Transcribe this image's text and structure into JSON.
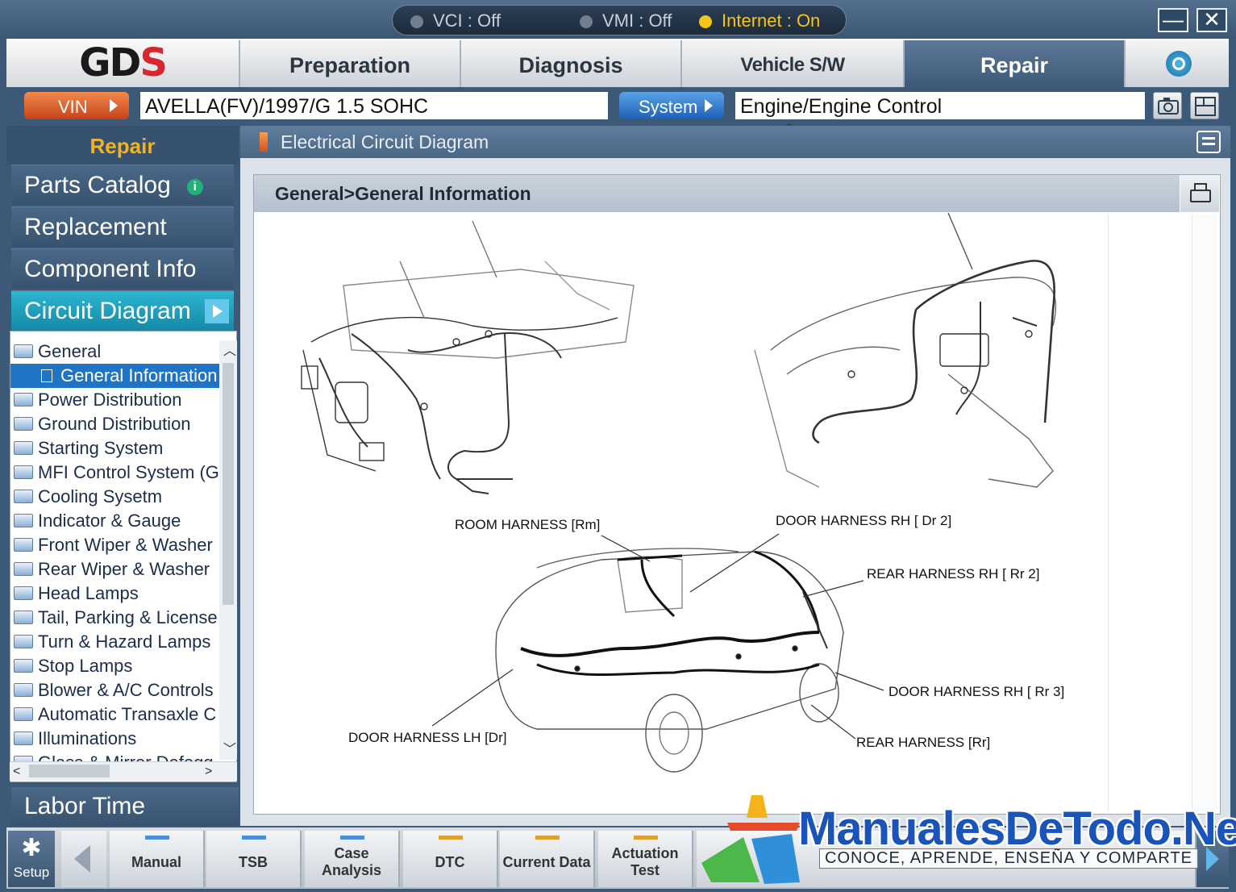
{
  "status": {
    "vci": "VCI : Off",
    "vmi": "VMI : Off",
    "internet": "Internet : On",
    "colors": {
      "off": "#6f7f8f",
      "on": "#f5c518"
    }
  },
  "window": {
    "minimize": "—",
    "close": "✕"
  },
  "logo": {
    "text_a": "GD",
    "text_b": "S"
  },
  "nav_tabs": [
    {
      "label": "Preparation"
    },
    {
      "label": "Diagnosis"
    },
    {
      "label": "Vehicle S/W Management"
    },
    {
      "label": "Repair"
    }
  ],
  "vin_bar": {
    "vin_label": "VIN",
    "vin_value": "AVELLA(FV)/1997/G 1.5 SOHC",
    "system_label": "System",
    "system_value": "Engine/Engine Control"
  },
  "sidebar": {
    "header": "Repair",
    "items": [
      {
        "label": "Parts Catalog",
        "badge": "i"
      },
      {
        "label": "Replacement"
      },
      {
        "label": "Component Info"
      },
      {
        "label": "Circuit Diagram"
      }
    ],
    "footer": "Labor Time"
  },
  "tree": {
    "root": "General",
    "selected": "General Information",
    "items": [
      "Power Distribution",
      "Ground Distribution",
      "Starting System",
      "MFI Control System (G",
      "Cooling Sysetm",
      "Indicator & Gauge",
      "Front Wiper & Washer",
      "Rear Wiper & Washer",
      "Head Lamps",
      "Tail, Parking & License",
      "Turn & Hazard Lamps",
      "Stop Lamps",
      "Blower & A/C Controls",
      "Automatic Transaxle C",
      "Illuminations",
      "Glass & Mirror Defogg"
    ]
  },
  "content": {
    "header": "Electrical Circuit Diagram",
    "breadcrumb": "General>General Information",
    "labels": {
      "room": "ROOM HARNESS [Rm]",
      "door_rh_dr2": "DOOR  HARNESS RH [ Dr 2]",
      "rear_rh_rr2": "REAR  HARNESS RH [ Rr 2]",
      "door_rh_rr3": "DOOR  HARNESS RH [ Rr 3]",
      "rear_rr": "REAR HARNESS [Rr]",
      "door_lh_dr": "DOOR HARNESS LH [Dr]"
    }
  },
  "bottom_bar": {
    "setup": "Setup",
    "buttons": [
      {
        "label": "Manual",
        "mark": "#4a90d9"
      },
      {
        "label": "TSB",
        "mark": "#4a90d9"
      },
      {
        "label": "Case Analysis",
        "mark": "#4a90d9"
      },
      {
        "label": "DTC",
        "mark": "#e0a030"
      },
      {
        "label": "Current Data",
        "mark": "#e0a030"
      },
      {
        "label": "Actuation\nTest",
        "mark": "#e0a030"
      }
    ]
  },
  "watermark": {
    "title": "ManualesDeTodo.Net",
    "subtitle": "CONOCE, APRENDE, ENSEÑA Y COMPARTE"
  }
}
